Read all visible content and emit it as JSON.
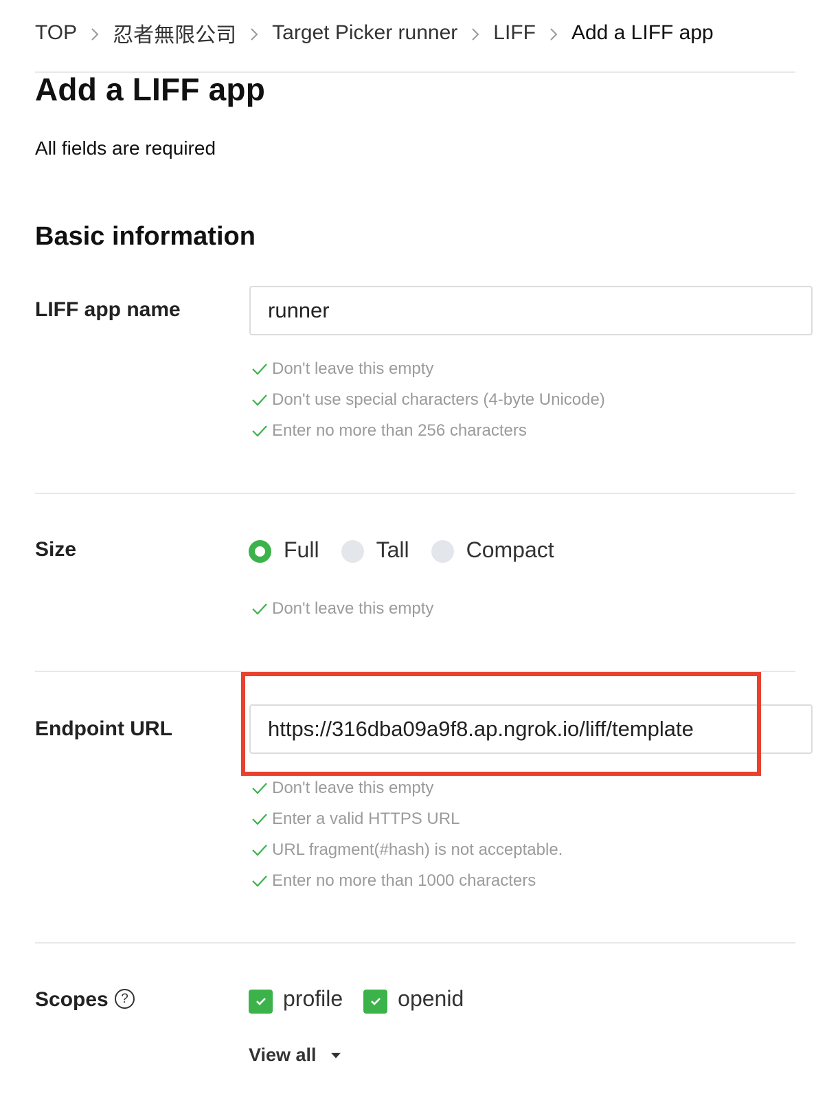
{
  "breadcrumb": {
    "items": [
      "TOP",
      "忍者無限公司",
      "Target Picker runner",
      "LIFF",
      "Add a LIFF app"
    ]
  },
  "page": {
    "title": "Add a LIFF app",
    "subtitle": "All fields are required"
  },
  "basic_info": {
    "section_title": "Basic information",
    "app_name": {
      "label": "LIFF app name",
      "value": "runner",
      "rules": [
        "Don't leave this empty",
        "Don't use special characters (4-byte Unicode)",
        "Enter no more than 256 characters"
      ]
    },
    "size": {
      "label": "Size",
      "options": [
        "Full",
        "Tall",
        "Compact"
      ],
      "selected": "Full",
      "rules": [
        "Don't leave this empty"
      ]
    },
    "endpoint": {
      "label": "Endpoint URL",
      "value": "https://316dba09a9f8.ap.ngrok.io/liff/template",
      "rules": [
        "Don't leave this empty",
        "Enter a valid HTTPS URL",
        "URL fragment(#hash) is not acceptable.",
        "Enter no more than 1000 characters"
      ]
    },
    "scopes": {
      "label": "Scopes",
      "help_icon": "?",
      "options": [
        "profile",
        "openid"
      ],
      "checked": [
        true,
        true
      ],
      "view_all": "View all"
    }
  },
  "colors": {
    "accent_green": "#3bb34a",
    "highlight_red": "#e8412d",
    "rule_text_gray": "#9b9b9b"
  }
}
